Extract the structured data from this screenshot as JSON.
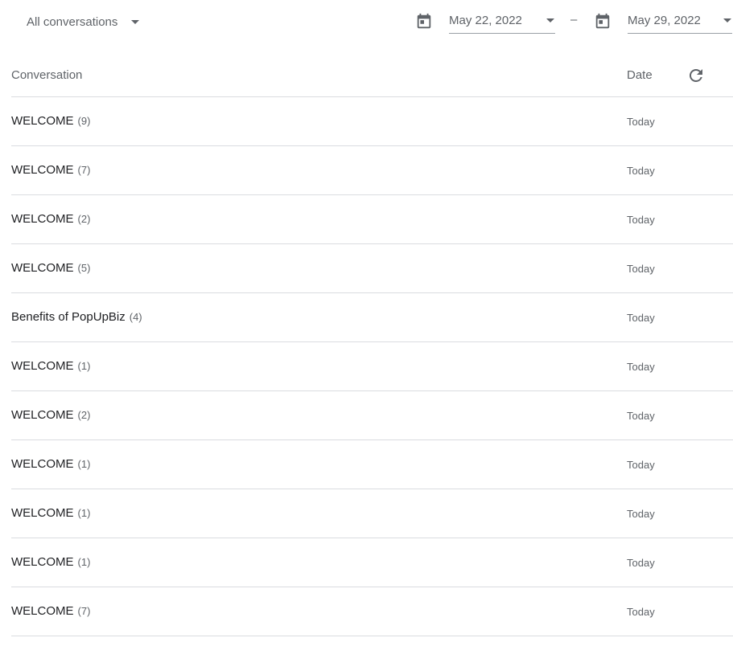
{
  "filter": {
    "selected": "All conversations"
  },
  "date_range": {
    "start": "May 22, 2022",
    "separator": "–",
    "end": "May 29, 2022"
  },
  "table": {
    "columns": {
      "conversation": "Conversation",
      "date": "Date"
    },
    "rows": [
      {
        "title": "WELCOME",
        "count": "(9)",
        "date": "Today"
      },
      {
        "title": "WELCOME",
        "count": "(7)",
        "date": "Today"
      },
      {
        "title": "WELCOME",
        "count": "(2)",
        "date": "Today"
      },
      {
        "title": "WELCOME",
        "count": "(5)",
        "date": "Today"
      },
      {
        "title": "Benefits of PopUpBiz",
        "count": "(4)",
        "date": "Today"
      },
      {
        "title": "WELCOME",
        "count": "(1)",
        "date": "Today"
      },
      {
        "title": "WELCOME",
        "count": "(2)",
        "date": "Today"
      },
      {
        "title": "WELCOME",
        "count": "(1)",
        "date": "Today"
      },
      {
        "title": "WELCOME",
        "count": "(1)",
        "date": "Today"
      },
      {
        "title": "WELCOME",
        "count": "(1)",
        "date": "Today"
      },
      {
        "title": "WELCOME",
        "count": "(7)",
        "date": "Today"
      }
    ]
  },
  "icons": {
    "calendar": "calendar-icon",
    "refresh": "refresh-icon",
    "dropdown": "caret-down-icon"
  },
  "colors": {
    "text_primary": "#202124",
    "text_secondary": "#5f6368",
    "icon": "#5f6368",
    "divider": "#dadce0"
  }
}
